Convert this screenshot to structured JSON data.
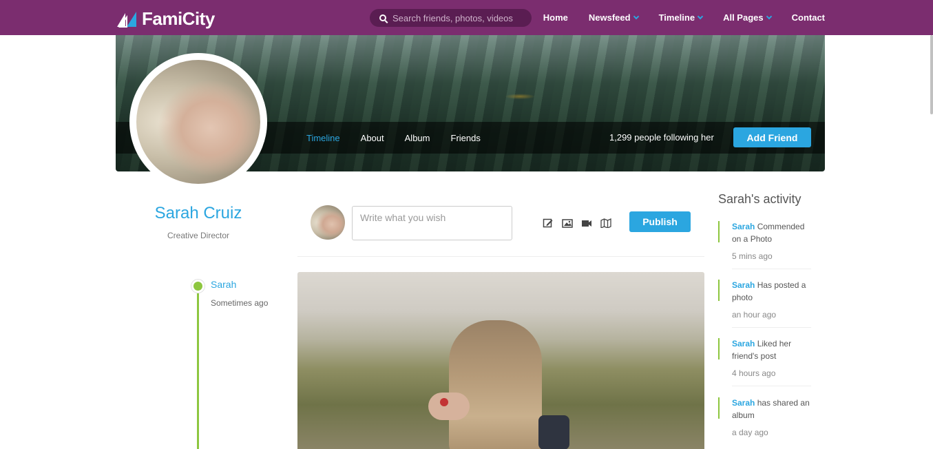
{
  "brand": {
    "name": "FamiCity"
  },
  "search": {
    "placeholder": "Search friends, photos, videos"
  },
  "nav": [
    {
      "label": "Home",
      "dropdown": false
    },
    {
      "label": "Newsfeed",
      "dropdown": true
    },
    {
      "label": "Timeline",
      "dropdown": true
    },
    {
      "label": "All Pages",
      "dropdown": true
    },
    {
      "label": "Contact",
      "dropdown": false
    }
  ],
  "cover": {
    "tabs": [
      {
        "label": "Timeline",
        "active": true
      },
      {
        "label": "About",
        "active": false
      },
      {
        "label": "Album",
        "active": false
      },
      {
        "label": "Friends",
        "active": false
      }
    ],
    "followers": "1,299 people following her",
    "add_friend_label": "Add Friend"
  },
  "profile": {
    "name": "Sarah Cruiz",
    "role": "Creative Director"
  },
  "timeline": {
    "name": "Sarah",
    "time": "Sometimes ago"
  },
  "composer": {
    "placeholder": "Write what you wish",
    "tools": [
      "edit-icon",
      "image-icon",
      "video-icon",
      "map-icon"
    ],
    "publish_label": "Publish"
  },
  "activity": {
    "title": "Sarah's activity",
    "items": [
      {
        "user": "Sarah",
        "text": " Commended on a Photo",
        "time": "5 mins ago"
      },
      {
        "user": "Sarah",
        "text": " Has posted a photo",
        "time": "an hour ago"
      },
      {
        "user": "Sarah",
        "text": " Liked her friend's post",
        "time": "4 hours ago"
      },
      {
        "user": "Sarah",
        "text": " has shared an album",
        "time": "a day ago"
      }
    ]
  },
  "colors": {
    "topbar": "#7b2d6f",
    "accent": "#2ba6e0",
    "timeline": "#8dc63f"
  }
}
